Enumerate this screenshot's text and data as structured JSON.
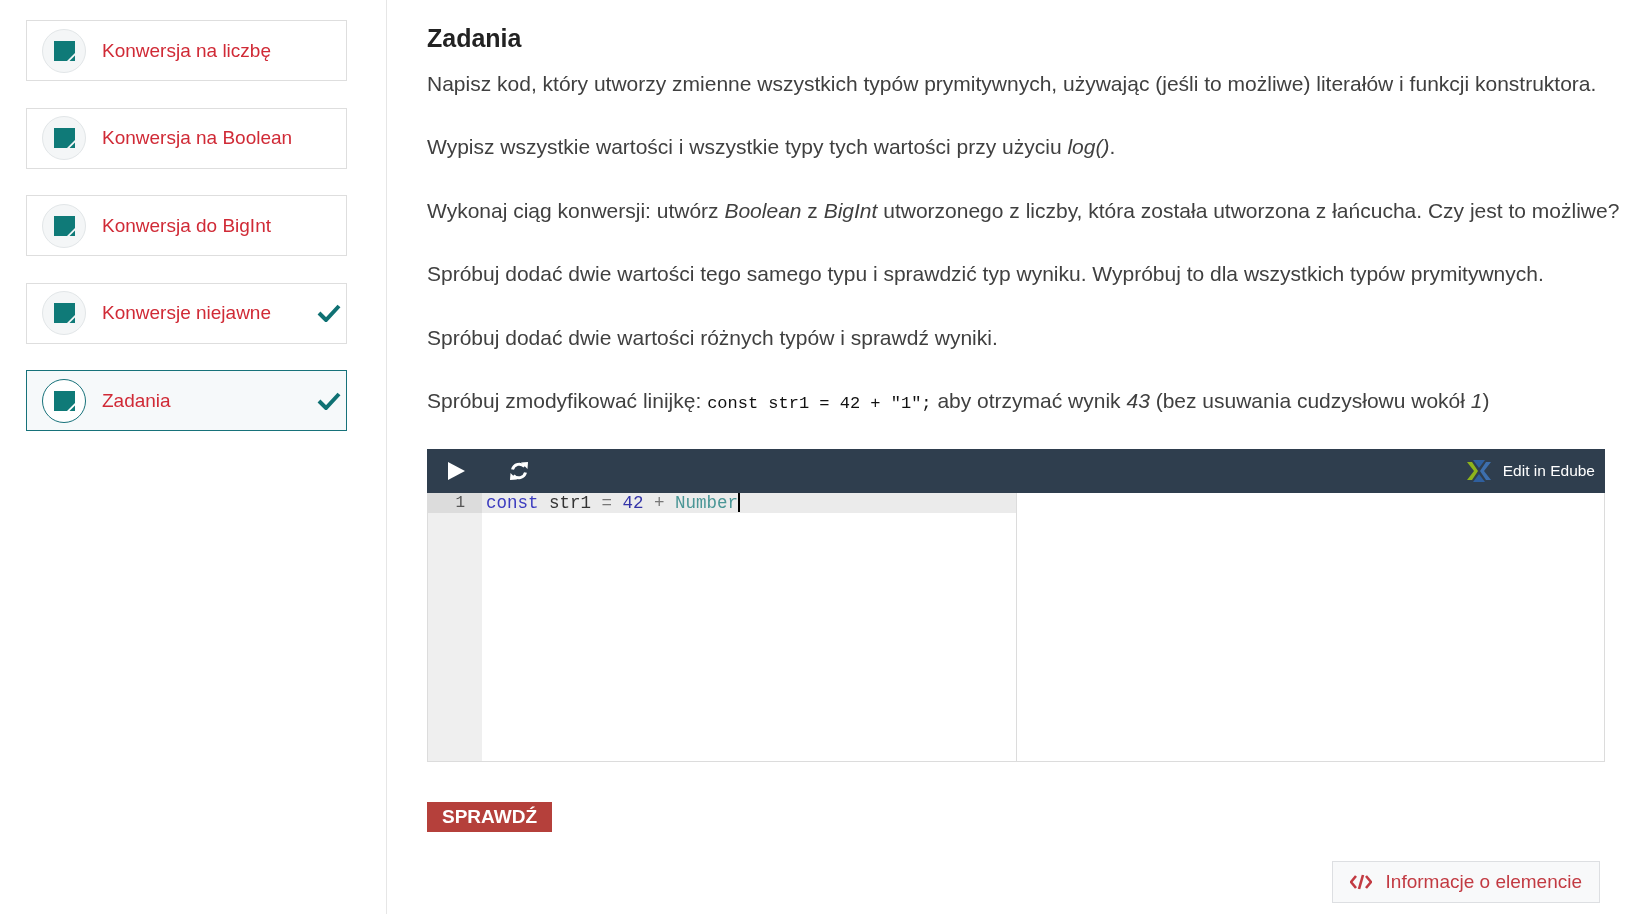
{
  "sidebar": {
    "items": [
      {
        "label": "Konwersja na liczbę",
        "completed": false,
        "selected": false
      },
      {
        "label": "Konwersja na Boolean",
        "completed": false,
        "selected": false
      },
      {
        "label": "Konwersja do BigInt",
        "completed": false,
        "selected": false
      },
      {
        "label": "Konwersje niejawne",
        "completed": true,
        "selected": false
      },
      {
        "label": "Zadania",
        "completed": true,
        "selected": true
      }
    ]
  },
  "content": {
    "title": "Zadania",
    "paragraphs": [
      {
        "parts": [
          {
            "kind": "text",
            "text": "Napisz kod, który utworzy zmienne wszystkich typów prymitywnych, używając (jeśli to możliwe) literałów i funkcji konstruktora."
          }
        ]
      },
      {
        "parts": [
          {
            "kind": "text",
            "text": "Wypisz wszystkie wartości i wszystkie typy tych wartości przy użyciu *log()*."
          }
        ]
      },
      {
        "parts": [
          {
            "kind": "text",
            "text": "Wykonaj ciąg konwersji: utwórz *Boolean* z *BigInt* utworzonego z liczby, która została utworzona z łańcucha. Czy jest to możliwe?"
          }
        ]
      },
      {
        "parts": [
          {
            "kind": "text",
            "text": "Spróbuj dodać dwie wartości tego samego typu i sprawdzić typ wyniku. Wypróbuj to dla wszystkich typów prymitywnych."
          }
        ]
      },
      {
        "parts": [
          {
            "kind": "text",
            "text": "Spróbuj dodać dwie wartości różnych typów i sprawdź wyniki."
          }
        ]
      },
      {
        "parts": [
          {
            "kind": "text",
            "text": "Spróbuj zmodyfikować linijkę: "
          },
          {
            "kind": "code",
            "text": "const str1 = 42 + \"1\";"
          },
          {
            "kind": "text",
            "text": " aby otrzymać wynik *43* (bez usuwania cudzysłowu wokół *1*)"
          }
        ]
      }
    ]
  },
  "editor": {
    "edit_link": "Edit in Edube",
    "lines": [
      {
        "number": "1",
        "active": true,
        "tokens": [
          {
            "kind": "keyword",
            "text": "const"
          },
          {
            "kind": "plain",
            "text": " str1 "
          },
          {
            "kind": "operator",
            "text": "="
          },
          {
            "kind": "number",
            "text": " 42 "
          },
          {
            "kind": "operator",
            "text": "+"
          },
          {
            "kind": "builtin",
            "text": " Number"
          }
        ]
      }
    ]
  },
  "check_button": "SPRAWDŹ",
  "info_button": "Informacje o elemencie"
}
